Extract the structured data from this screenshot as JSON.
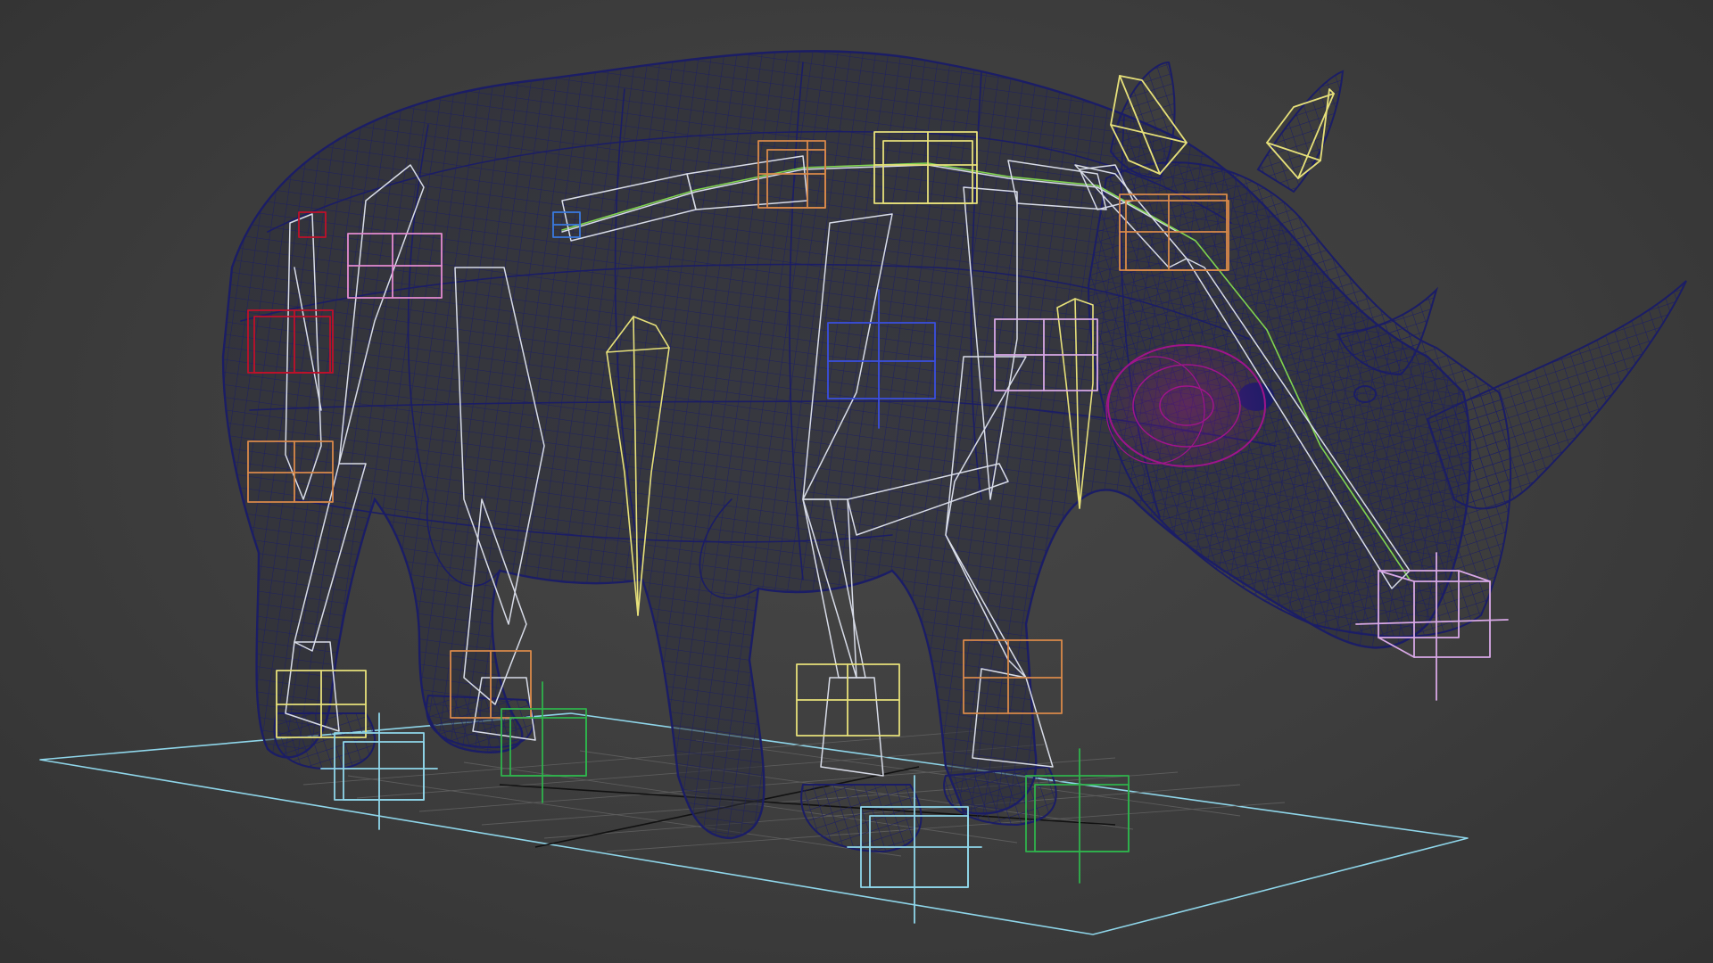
{
  "viewport": {
    "background": "#3b3b3b"
  },
  "colors": {
    "mesh": "#1b1d66",
    "mesh_light": "#2a2f86",
    "bone_white": "#d8dce8",
    "spine_link": "#7fd44f",
    "helper_orange": "#d9894a",
    "helper_yellow": "#e6e07a",
    "helper_pink": "#e48ad0",
    "helper_red": "#c0102a",
    "helper_blue": "#3a4fe0",
    "helper_green": "#2fb24c",
    "helper_cyan": "#8fd6ea",
    "helper_lavender": "#d8a8e6",
    "eye_rig": "#a0148c",
    "ground_plane": "#8fd6ea",
    "grid": "#5a5a5a"
  },
  "scene": {
    "model": "rhino",
    "display": "wireframe",
    "icons": [
      "rhino-mesh-icon",
      "bone-icon",
      "controller-box-icon",
      "grid-icon"
    ]
  }
}
